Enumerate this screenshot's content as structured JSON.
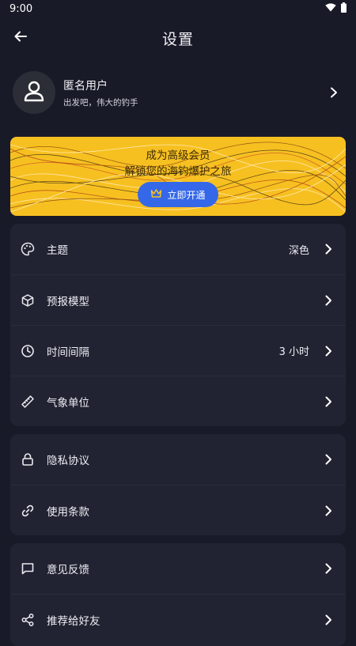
{
  "status": {
    "time": "9:00"
  },
  "header": {
    "title": "设置"
  },
  "profile": {
    "name": "匿名用户",
    "subtitle": "出发吧，伟大的钓手"
  },
  "banner": {
    "line1": "成为高级会员",
    "line2": "解锁您的海钓爆护之旅",
    "button_label": "立即开通"
  },
  "groups": {
    "general": [
      {
        "label": "主题",
        "value": "深色",
        "icon": "palette-icon"
      },
      {
        "label": "预报模型",
        "value": "",
        "icon": "cube-icon"
      },
      {
        "label": "时间间隔",
        "value": "3 小时",
        "icon": "clock-icon"
      },
      {
        "label": "气象单位",
        "value": "",
        "icon": "ruler-icon"
      }
    ],
    "legal": [
      {
        "label": "隐私协议",
        "icon": "lock-icon"
      },
      {
        "label": "使用条款",
        "icon": "link-icon"
      }
    ],
    "support": [
      {
        "label": "意见反馈",
        "icon": "message-icon"
      },
      {
        "label": "推荐给好友",
        "icon": "share-icon"
      }
    ]
  },
  "colors": {
    "background": "#191a28",
    "card": "#222332",
    "banner": "#f7c021",
    "accent": "#3568e8"
  }
}
